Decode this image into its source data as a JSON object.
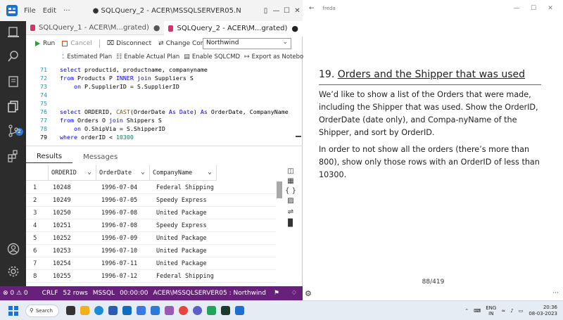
{
  "ads": {
    "menu": [
      "File",
      "Edit",
      "···"
    ],
    "window_title": "● SQLQuery_2 - ACER\\MSSQLSERVER05.Northwind (Inte...",
    "tabs": [
      {
        "label": "SQLQuery_1 - ACER\\M...grated)",
        "modified": "●"
      },
      {
        "label": "SQLQuery_2 - ACER\\M...grated)",
        "modified": "●"
      }
    ],
    "toolbar": {
      "run": "Run",
      "cancel": "Cancel",
      "disconnect": "Disconnect",
      "change_connection": "Change Connection",
      "database": "Northwind",
      "estimated_plan": "Estimated Plan",
      "enable_actual_plan": "Enable Actual Plan",
      "enable_sqlcmd": "Enable SQLCMD",
      "export_notebook": "Export as Notebook"
    },
    "code_lines": [
      {
        "n": "71",
        "t": [
          [
            "kw",
            "select"
          ],
          [
            "mid",
            " productid, productname, companyname"
          ]
        ]
      },
      {
        "n": "72",
        "t": [
          [
            "kw",
            "from"
          ],
          [
            "mid",
            " Products P "
          ],
          [
            "kw",
            "INNER join"
          ],
          [
            "mid",
            " Suppliers S"
          ]
        ]
      },
      {
        "n": "73",
        "t": [
          [
            "mid",
            "    "
          ],
          [
            "kw",
            "on"
          ],
          [
            "mid",
            " P.SupplierID = S.SupplierID"
          ]
        ]
      },
      {
        "n": "74",
        "t": []
      },
      {
        "n": "75",
        "t": []
      },
      {
        "n": "76",
        "t": [
          [
            "kw",
            "select"
          ],
          [
            "mid",
            " ORDERID, "
          ],
          [
            "fn",
            "CAST"
          ],
          [
            "mid",
            "(OrderDate "
          ],
          [
            "kw",
            "As Date"
          ],
          [
            "mid",
            ") "
          ],
          [
            "kw",
            "As"
          ],
          [
            "mid",
            " OrderDate, CompanyName"
          ]
        ]
      },
      {
        "n": "77",
        "t": [
          [
            "kw",
            "from"
          ],
          [
            "mid",
            " Orders O "
          ],
          [
            "kw",
            "join"
          ],
          [
            "mid",
            " Shippers S"
          ]
        ]
      },
      {
        "n": "78",
        "t": [
          [
            "mid",
            "    "
          ],
          [
            "kw",
            "on"
          ],
          [
            "mid",
            " O.ShipVia = S.ShipperID"
          ]
        ]
      },
      {
        "n": "79",
        "t": [
          [
            "kw",
            "where"
          ],
          [
            "mid",
            " orderID < "
          ],
          [
            "num",
            "10300"
          ]
        ]
      }
    ],
    "results_tabs": [
      "Results",
      "Messages"
    ],
    "grid": {
      "columns": [
        "ORDERID",
        "OrderDate",
        "CompanyName"
      ],
      "rows": [
        [
          "1",
          "10248",
          "1996-07-04",
          "Federal Shipping"
        ],
        [
          "2",
          "10249",
          "1996-07-05",
          "Speedy Express"
        ],
        [
          "3",
          "10250",
          "1996-07-08",
          "United Package"
        ],
        [
          "4",
          "10251",
          "1996-07-08",
          "Speedy Express"
        ],
        [
          "5",
          "10252",
          "1996-07-09",
          "United Package"
        ],
        [
          "6",
          "10253",
          "1996-07-10",
          "United Package"
        ],
        [
          "7",
          "10254",
          "1996-07-11",
          "United Package"
        ],
        [
          "8",
          "10255",
          "1996-07-12",
          "Federal Shipping"
        ]
      ]
    },
    "status": {
      "problems": "⊗ 0 ⚠ 0",
      "eol": "CRLF",
      "rows": "52 rows",
      "lang": "MSSQL",
      "time": "00:00:00",
      "server": "ACER\\MSSQLSERVER05 : Northwind"
    }
  },
  "pdf": {
    "window_title": "freda",
    "heading_num": "19.",
    "heading_text": "Orders and the Shipper that was used",
    "para1": "We’d like to show a list of the Orders that were made, including the Shipper that was used. Show the OrderID, OrderDate (date only), and Compa-nyName of the Shipper, and sort by OrderID.",
    "para2": "In order to not show all the orders (there’s more than 800), show only those rows with an OrderID of less than 10300.",
    "page_number": "88/419"
  },
  "taskbar": {
    "search": "Search",
    "lang_top": "ENG",
    "lang_bottom": "IN",
    "time": "20:36",
    "date": "08-03-2023"
  }
}
